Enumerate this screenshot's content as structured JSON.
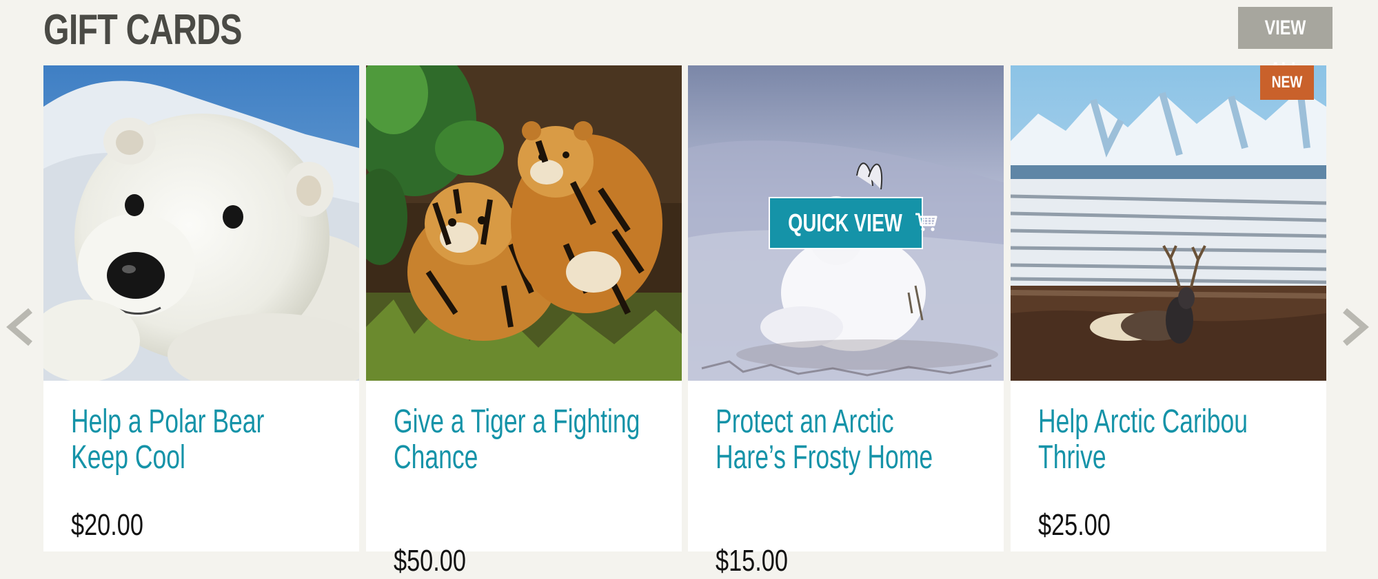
{
  "section": {
    "title": "GIFT CARDS",
    "view_all_label": "VIEW ALL"
  },
  "carousel": {
    "prev_icon": "chevron-left-icon",
    "next_icon": "chevron-right-icon"
  },
  "cards": [
    {
      "title": "Help a Polar Bear Keep Cool",
      "price": "$20.00",
      "image": "polar-bear-cub-photo"
    },
    {
      "title": "Give a Tiger a Fighting Chance",
      "price": "$50.00",
      "image": "tiger-cubs-photo"
    },
    {
      "title": "Protect an Arctic Hare’s Frosty Home",
      "price": "$15.00",
      "image": "arctic-hare-photo",
      "quick_view_label": "QUICK VIEW",
      "quick_view_icon": "cart-icon"
    },
    {
      "title": "Help Arctic Caribou Thrive",
      "price": "$25.00",
      "image": "caribou-tundra-photo",
      "badge": "NEW"
    }
  ],
  "colors": {
    "background": "#f4f3ee",
    "title_text": "#4a4a45",
    "accent_teal": "#1593a8",
    "view_all_bg": "#a7a69e",
    "badge_new_bg": "#c9612b",
    "price_text": "#111111"
  }
}
